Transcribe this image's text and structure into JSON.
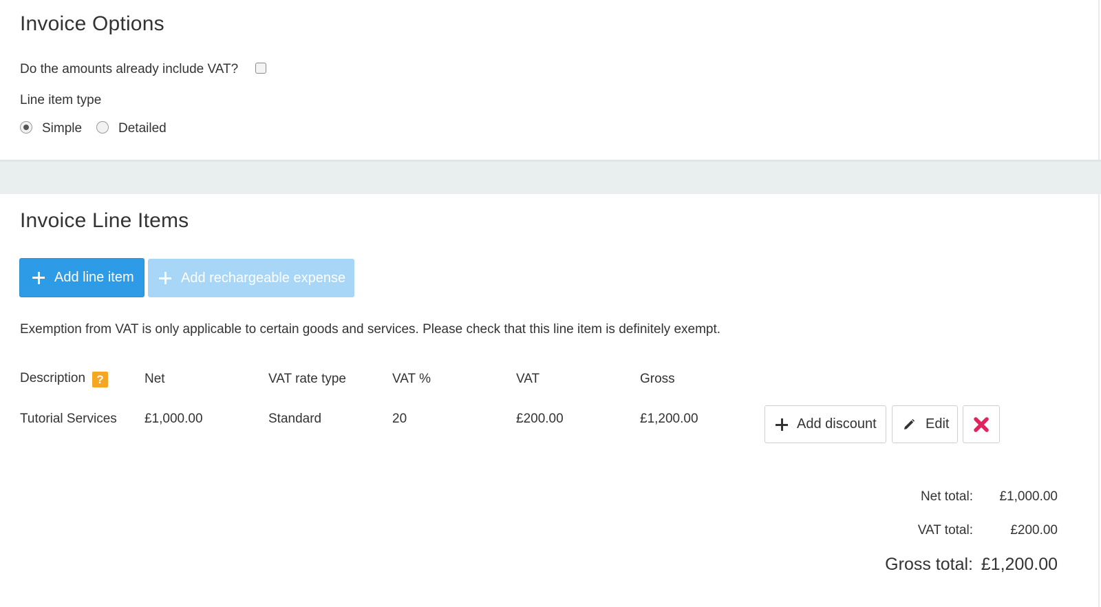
{
  "options": {
    "title": "Invoice Options",
    "vat_question": "Do the amounts already include VAT?",
    "vat_included": false,
    "line_item_type_label": "Line item type",
    "line_item_types": [
      "Simple",
      "Detailed"
    ],
    "selected_type": "Simple"
  },
  "line_items": {
    "title": "Invoice Line Items",
    "add_line_item_label": "Add line item",
    "add_expense_label": "Add rechargeable expense",
    "notice": "Exemption from VAT is only applicable to certain goods and services. Please check that this line item is definitely exempt.",
    "columns": [
      "Description",
      "Net",
      "VAT rate type",
      "VAT %",
      "VAT",
      "Gross"
    ],
    "help_icon_glyph": "?",
    "rows": [
      {
        "description": "Tutorial Services",
        "net": "£1,000.00",
        "vat_rate_type": "Standard",
        "vat_percent": "20",
        "vat": "£200.00",
        "gross": "£1,200.00"
      }
    ],
    "add_discount_label": "Add discount",
    "edit_label": "Edit"
  },
  "totals": {
    "net_label": "Net total:",
    "net_value": "£1,000.00",
    "vat_label": "VAT total:",
    "vat_value": "£200.00",
    "gross_label": "Gross total:",
    "gross_value": "£1,200.00"
  },
  "icons": {
    "add_line_item": "plus-icon",
    "add_expense": "plus-icon",
    "add_discount": "plus-icon",
    "edit": "pencil-icon",
    "delete": "close-icon",
    "help": "question-icon"
  },
  "colors": {
    "primary": "#2e9be6",
    "primary_disabled": "#a7d6f6",
    "delete": "#e0245e",
    "help": "#f5a623",
    "divider": "#e8efee"
  }
}
